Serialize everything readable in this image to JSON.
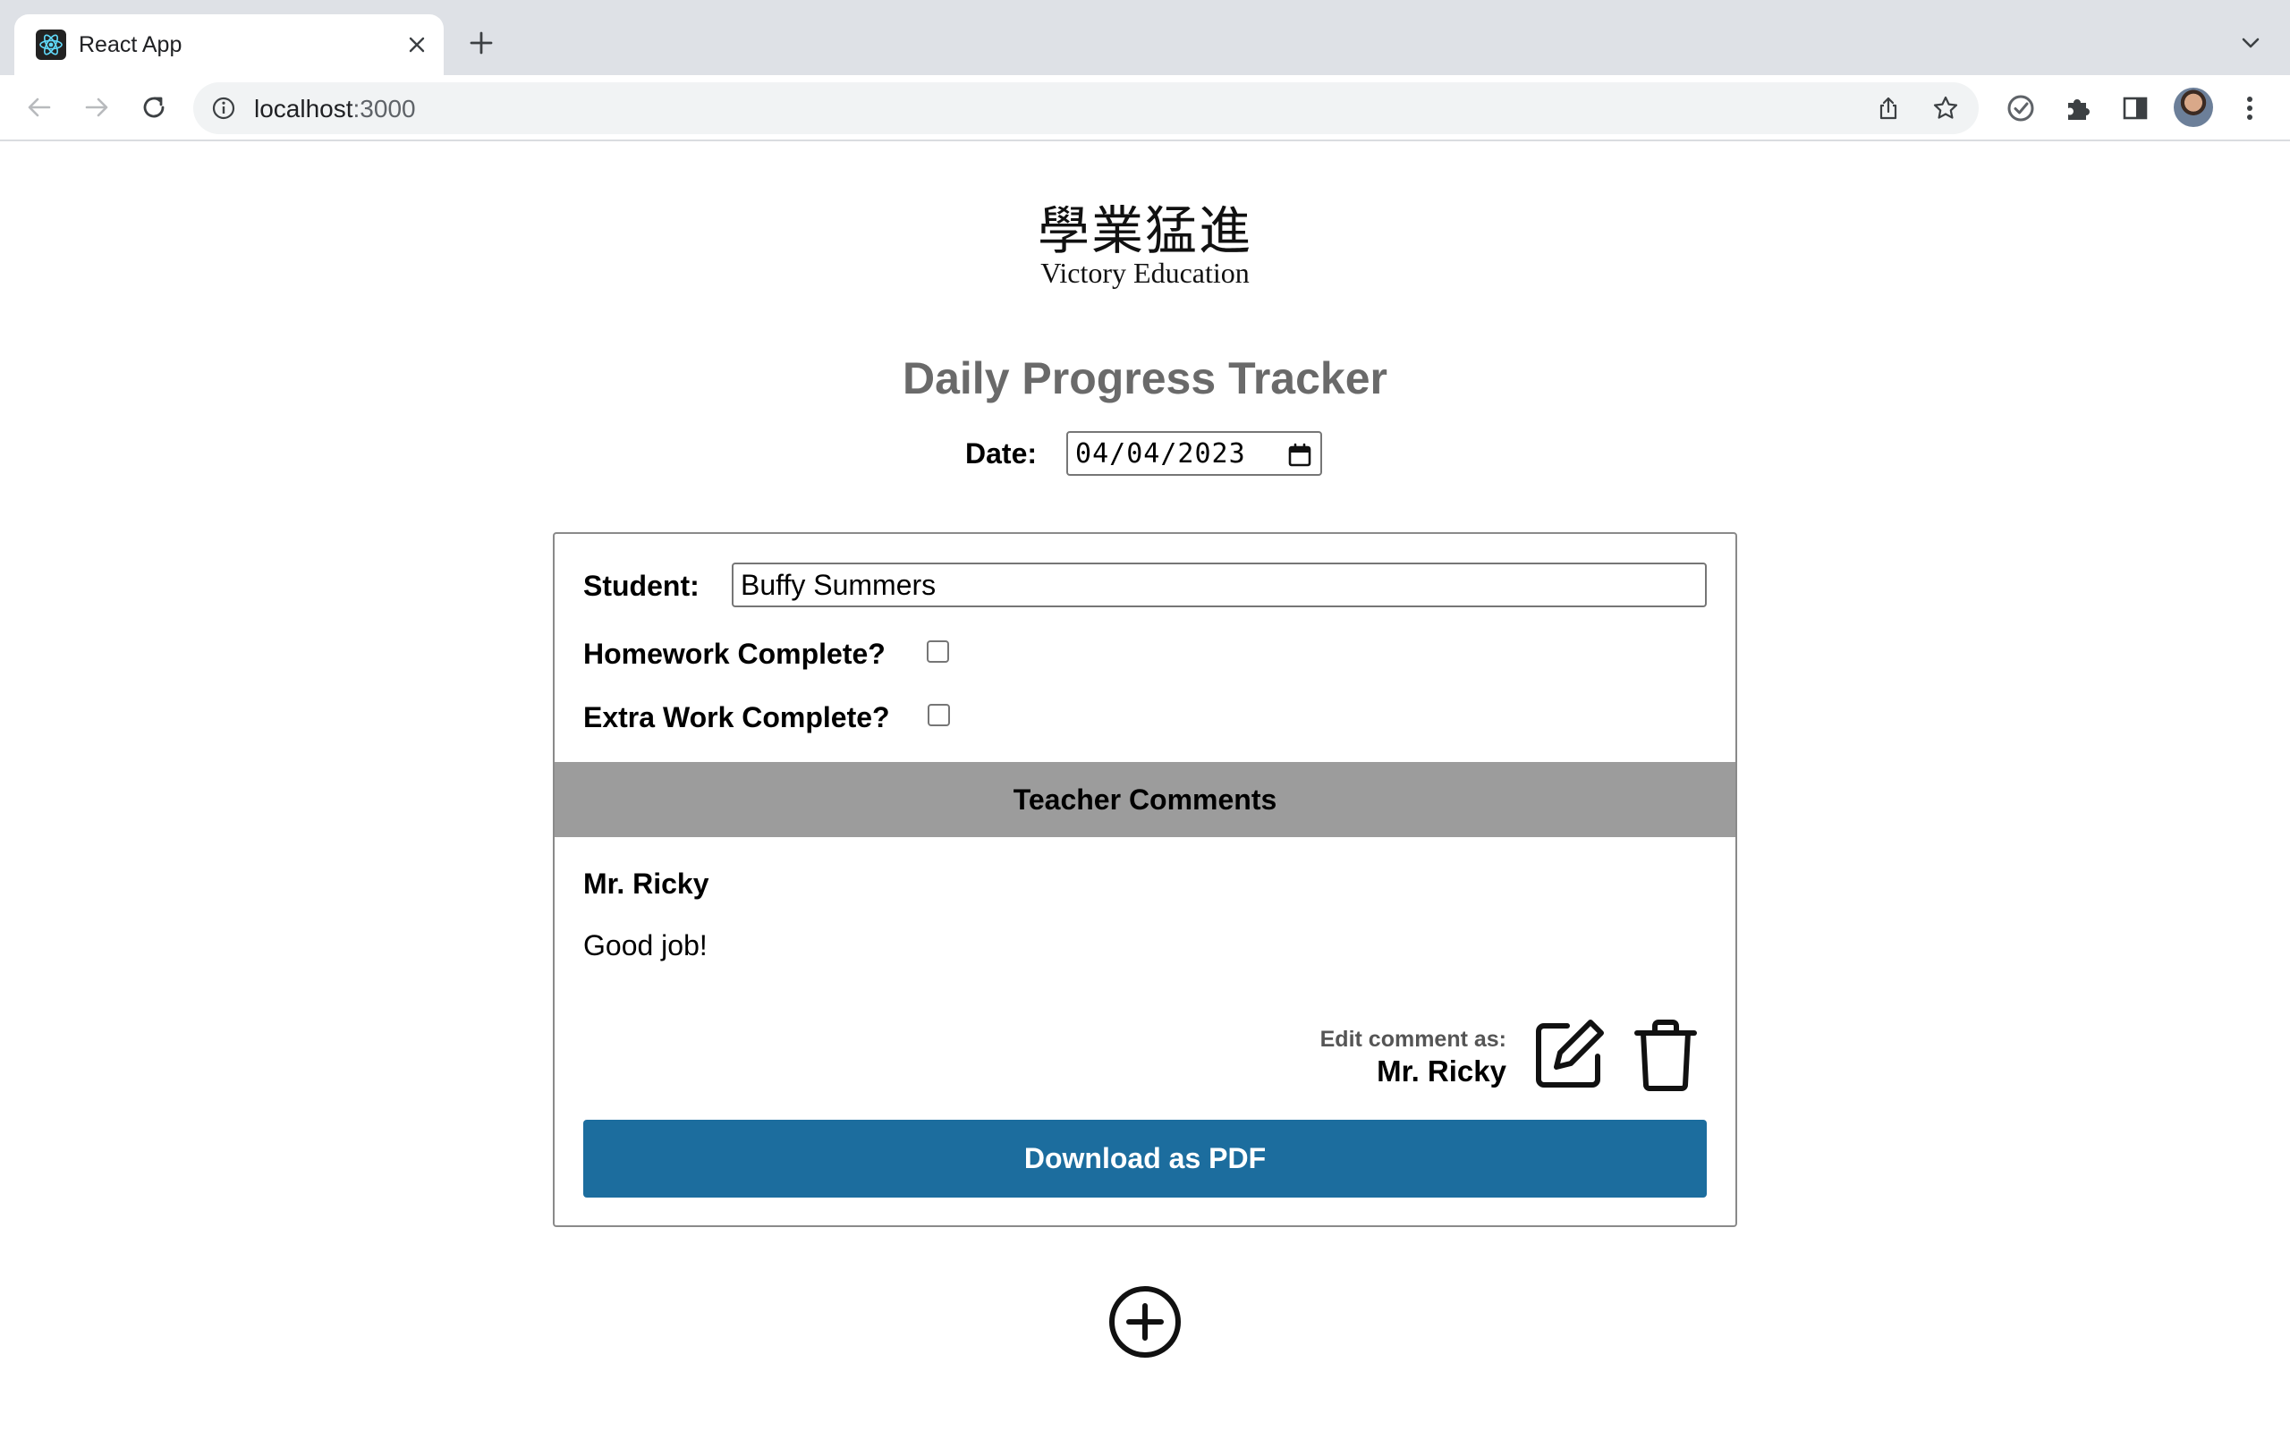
{
  "browser": {
    "tab_title": "React App",
    "url_host": "localhost",
    "url_port": ":3000"
  },
  "logo": {
    "cjk": "學業猛進",
    "english": "Victory Education"
  },
  "page": {
    "title": "Daily Progress Tracker",
    "date_label": "Date:",
    "date_value": "04/04/2023"
  },
  "form": {
    "student_label": "Student:",
    "student_value": "Buffy Summers",
    "homework_label": "Homework Complete?",
    "homework_checked": false,
    "extra_label": "Extra Work Complete?",
    "extra_checked": false
  },
  "comments": {
    "header": "Teacher Comments",
    "items": [
      {
        "author": "Mr. Ricky",
        "text": "Good job!"
      }
    ],
    "edit_as_label": "Edit comment as:",
    "edit_as_name": "Mr. Ricky"
  },
  "actions": {
    "download_pdf": "Download as PDF"
  },
  "icons": {
    "edit": "edit-icon",
    "delete": "trash-icon",
    "add": "plus-circle-icon"
  },
  "colors": {
    "primary_button": "#1c6d9e",
    "comments_header_bg": "#9c9c9c",
    "title_gray": "#6a6a6a"
  }
}
